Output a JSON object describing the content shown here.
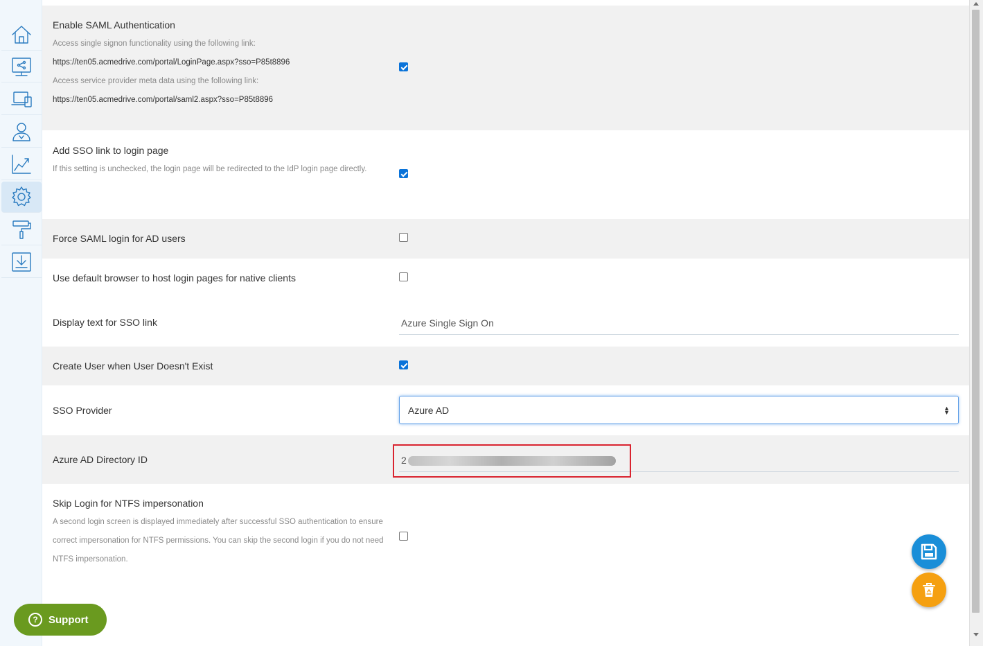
{
  "sidebar": {
    "items": [
      {
        "icon": "home-icon"
      },
      {
        "icon": "shared-folder-icon"
      },
      {
        "icon": "devices-icon"
      },
      {
        "icon": "users-icon"
      },
      {
        "icon": "reports-chart-icon"
      },
      {
        "icon": "settings-gear-icon",
        "active": true
      },
      {
        "icon": "customize-paint-roller-icon"
      },
      {
        "icon": "download-icon"
      }
    ]
  },
  "settings": {
    "saml": {
      "label": "Enable SAML Authentication",
      "desc1": "Access single signon functionality using the following link:",
      "link1": "https://ten05.acmedrive.com/portal/LoginPage.aspx?sso=P85t8896",
      "desc2": "Access service provider meta data using the following link:",
      "link2": "https://ten05.acmedrive.com/portal/saml2.aspx?sso=P85t8896",
      "checked": true
    },
    "sso_link": {
      "label": "Add SSO link to login page",
      "desc": "If this setting is unchecked, the login page will be redirected to the IdP login page directly.",
      "checked": true
    },
    "force_saml": {
      "label": "Force SAML login for AD users",
      "checked": false
    },
    "default_browser": {
      "label": "Use default browser to host login pages for native clients",
      "checked": false
    },
    "display_text": {
      "label": "Display text for SSO link",
      "value": "Azure Single Sign On"
    },
    "create_user": {
      "label": "Create User when User Doesn't Exist",
      "checked": true
    },
    "sso_provider": {
      "label": "SSO Provider",
      "value": "Azure AD"
    },
    "azure_dir_id": {
      "label": "Azure AD Directory ID",
      "value": "2"
    },
    "skip_login": {
      "label": "Skip Login for NTFS impersonation",
      "desc": "A second login screen is displayed immediately after successful SSO authentication to ensure correct impersonation for NTFS permissions. You can skip the second login if you do not need NTFS impersonation.",
      "checked": false
    }
  },
  "actions": {
    "save_icon": "save-floppy-icon",
    "clear_icon": "recycle-bin-icon"
  },
  "support": {
    "label": "Support"
  },
  "colors": {
    "accent": "#2a7bc0",
    "checkbox": "#0a73d9",
    "save": "#1a8ed8",
    "clear": "#f5a011",
    "support": "#6a9a1f",
    "highlight": "#d9232f"
  }
}
